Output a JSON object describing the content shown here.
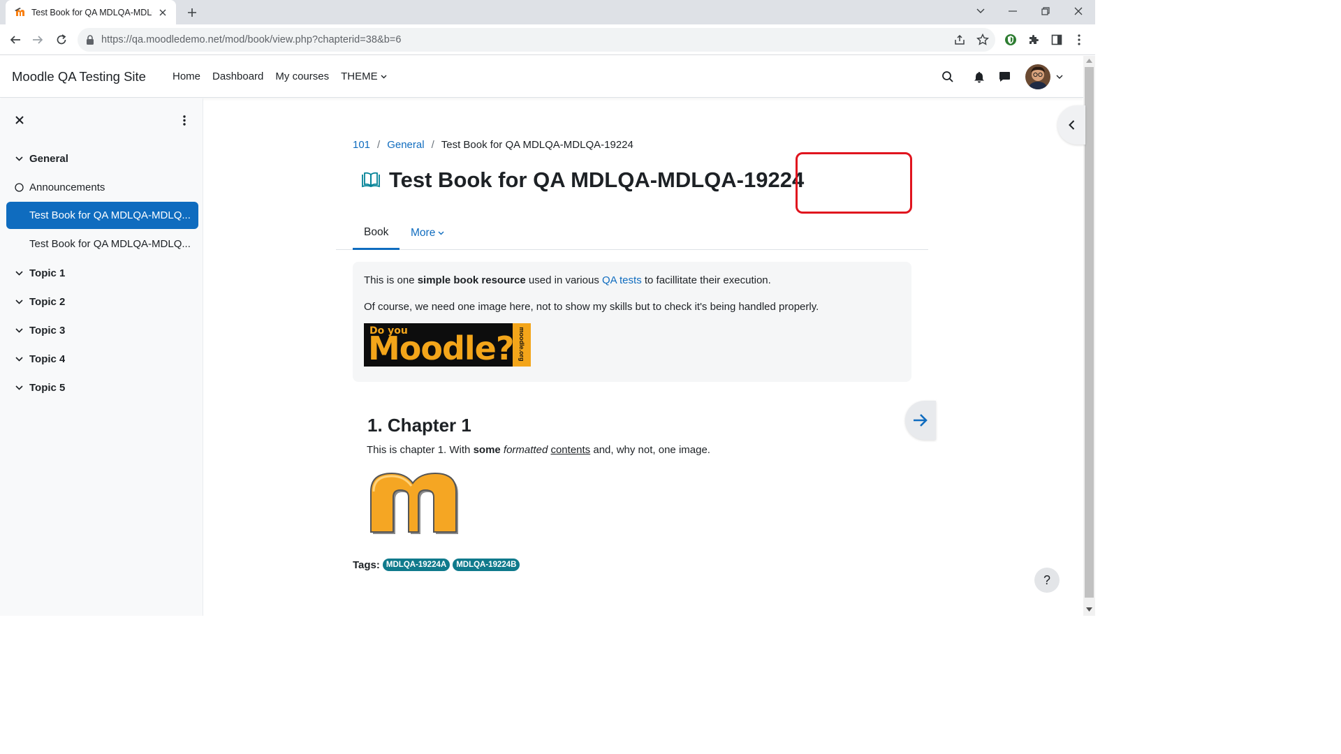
{
  "browser": {
    "tab_title": "Test Book for QA MDLQA-MDLQA",
    "url_host": "https://qa.moodledemo.net",
    "url_path": "/mod/book/view.php?chapterid=38&b=6"
  },
  "navbar": {
    "brand": "Moodle QA Testing Site",
    "items": [
      {
        "label": "Home"
      },
      {
        "label": "Dashboard"
      },
      {
        "label": "My courses"
      },
      {
        "label": "THEME"
      }
    ]
  },
  "course_index": {
    "items": [
      {
        "label": "General",
        "type": "section"
      },
      {
        "label": "Announcements",
        "type": "activity"
      },
      {
        "label": "Test Book for QA MDLQA-MDLQ...",
        "type": "activity",
        "active": true
      },
      {
        "label": "Test Book for QA MDLQA-MDLQ...",
        "type": "activity"
      },
      {
        "label": "Topic 1",
        "type": "section"
      },
      {
        "label": "Topic 2",
        "type": "section"
      },
      {
        "label": "Topic 3",
        "type": "section"
      },
      {
        "label": "Topic 4",
        "type": "section"
      },
      {
        "label": "Topic 5",
        "type": "section"
      }
    ]
  },
  "breadcrumb": [
    "101",
    "General",
    "Test Book for QA MDLQA-MDLQA-19224"
  ],
  "page": {
    "title": "Test Book for QA MDLQA-MDLQA-19224",
    "tabs": [
      {
        "label": "Book"
      },
      {
        "label": "More"
      }
    ]
  },
  "intro": {
    "p1_a": "This is one ",
    "p1_bold": "simple book resource",
    "p1_b": " used in various ",
    "p1_link": "QA tests",
    "p1_c": " to facillitate their execution.",
    "p2": "Of course, we need one image here, not to show my skills but to check it's being handled properly.",
    "banner_small": "Do you",
    "banner_big": "Moodle?",
    "banner_side": "moodle.org"
  },
  "chapter": {
    "title": "1. Chapter 1",
    "t1": "This is chapter 1. With ",
    "t_bold": "some",
    "t_italic": "formatted",
    "t_under": "contents",
    "t2": " and, why not, one image."
  },
  "tags": {
    "label": "Tags:",
    "items": [
      "MDLQA-19224A",
      "MDLQA-19224B"
    ]
  },
  "help": "?",
  "colors": {
    "primary": "#0f6cbf",
    "tag": "#0f7a8c",
    "highlight": "#e0141e"
  }
}
